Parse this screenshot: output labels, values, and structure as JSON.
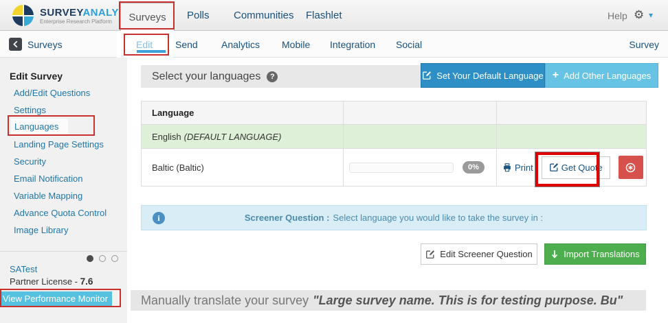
{
  "brand": {
    "word1": "SURVEY",
    "word2": "ANALYTICS",
    "tagline": "Enterprise Research Platform"
  },
  "topnav": {
    "active": "Surveys",
    "items": [
      "Polls",
      "Communities",
      "Flashlet"
    ],
    "help": "Help"
  },
  "subnav": {
    "back": "Surveys",
    "tabs": [
      "Edit",
      "Send",
      "Analytics",
      "Mobile",
      "Integration",
      "Social"
    ],
    "right": "Survey"
  },
  "sidebar": {
    "title": "Edit Survey",
    "items": [
      "Add/Edit Questions",
      "Settings",
      "Languages",
      "Landing Page Settings",
      "Security",
      "Email Notification",
      "Variable Mapping",
      "Advance Quota Control",
      "Image Library"
    ],
    "account_name": "SATest",
    "license_label": "Partner License - ",
    "license_value": "7.6",
    "monitor": "View Performance Monitor"
  },
  "main": {
    "title": "Select your languages",
    "btn_set_default": "Set Your Default Language",
    "btn_add_other": "Add Other Languages",
    "table": {
      "col_language": "Language",
      "row_default_name": "English",
      "row_default_tag": "(DEFAULT LANGUAGE)",
      "row_lang_name": "Baltic (Baltic)",
      "row_lang_progress": "0%",
      "action_print": "Print",
      "action_quote": "Get Quote"
    },
    "info_bold": "Screener Question :",
    "info_text": "Select language you would like to take the survey in :",
    "btn_edit_screener": "Edit Screener Question",
    "btn_import": "Import Translations",
    "footer_prefix": "Manually translate your survey",
    "footer_quote": "\"Large survey name. This is for testing purpose. Bu\""
  },
  "colors": {
    "accent_blue": "#2d8fc6",
    "light_blue": "#66c3e4",
    "green": "#4cae4c",
    "delete_red": "#d6504c",
    "annotation_red": "#c8302b",
    "info_bg": "#d9edf7",
    "default_row_green": "#dff0d8",
    "monitor_cyan": "#56c0e0"
  }
}
